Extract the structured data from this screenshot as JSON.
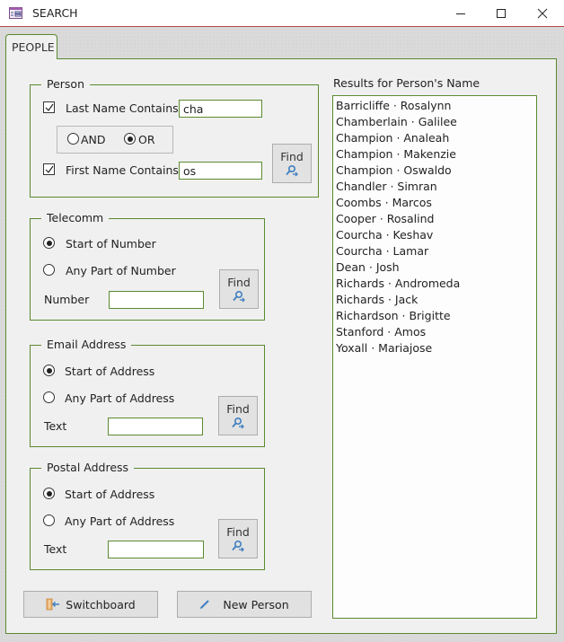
{
  "window": {
    "title": "SEARCH",
    "minimize_icon": "minimize-icon",
    "maximize_icon": "maximize-icon",
    "close_icon": "close-icon"
  },
  "tabs": [
    {
      "label": "PEOPLE",
      "active": true
    }
  ],
  "person": {
    "legend": "Person",
    "last_name_label": "Last Name Contains",
    "last_name_checked": true,
    "last_name_value": "cha",
    "and_label": "AND",
    "or_label": "OR",
    "logic_selected": "OR",
    "first_name_label": "First Name Contains",
    "first_name_checked": true,
    "first_name_value": "os",
    "find_label": "Find"
  },
  "telecomm": {
    "legend": "Telecomm",
    "start_label": "Start of Number",
    "any_label": "Any Part of Number",
    "selected": "start",
    "number_label": "Number",
    "number_value": "",
    "find_label": "Find"
  },
  "email": {
    "legend": "Email Address",
    "start_label": "Start of Address",
    "any_label": "Any Part of Address",
    "selected": "start",
    "text_label": "Text",
    "text_value": "",
    "find_label": "Find"
  },
  "postal": {
    "legend": "Postal Address",
    "start_label": "Start of Address",
    "any_label": "Any Part of Address",
    "selected": "start",
    "text_label": "Text",
    "text_value": "",
    "find_label": "Find"
  },
  "results": {
    "label": "Results for Person's Name",
    "items": [
      "Barricliffe · Rosalynn",
      "Chamberlain · Galilee",
      "Champion · Analeah",
      "Champion · Makenzie",
      "Champion · Oswaldo",
      "Chandler · Simran",
      "Coombs · Marcos",
      "Cooper · Rosalind",
      "Courcha · Keshav",
      "Courcha · Lamar",
      "Dean · Josh",
      "Richards · Andromeda",
      "Richards · Jack",
      "Richardson · Brigitte",
      "Stanford · Amos",
      "Yoxall · Mariajose"
    ]
  },
  "buttons": {
    "switchboard": "Switchboard",
    "new_person": "New Person"
  },
  "colors": {
    "accent_border": "#5a8a30",
    "titlebar_border": "#b84646",
    "icon_blue": "#3f7fc0"
  }
}
